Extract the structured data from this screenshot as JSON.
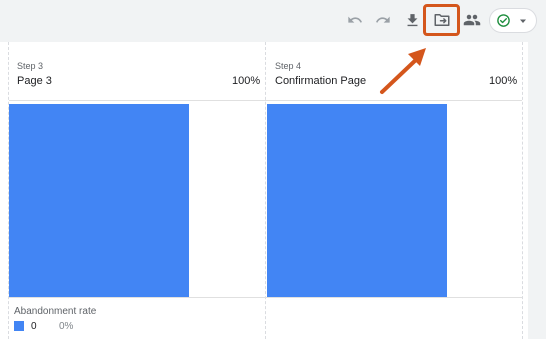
{
  "toolbar": {
    "icons": [
      "undo-icon",
      "redo-icon",
      "download-icon",
      "export-to-folder-icon",
      "share-users-icon",
      "check-circle-icon",
      "dropdown-arrow-icon"
    ],
    "colors": {
      "icon": "#5f6368",
      "highlight": "#d4561c",
      "check": "#1e8e3e"
    }
  },
  "funnel": {
    "steps": [
      {
        "label": "Step 3",
        "name": "Page 3",
        "percent": "100%",
        "bar_fraction": 1.0
      },
      {
        "label": "Step 4",
        "name": "Confirmation Page",
        "percent": "100%",
        "bar_fraction": 1.0
      }
    ],
    "abandonment": {
      "label": "Abandonment rate",
      "count": "0",
      "percent": "0%"
    },
    "colors": {
      "bar": "#4285f4",
      "divider": "#dadce0"
    }
  }
}
